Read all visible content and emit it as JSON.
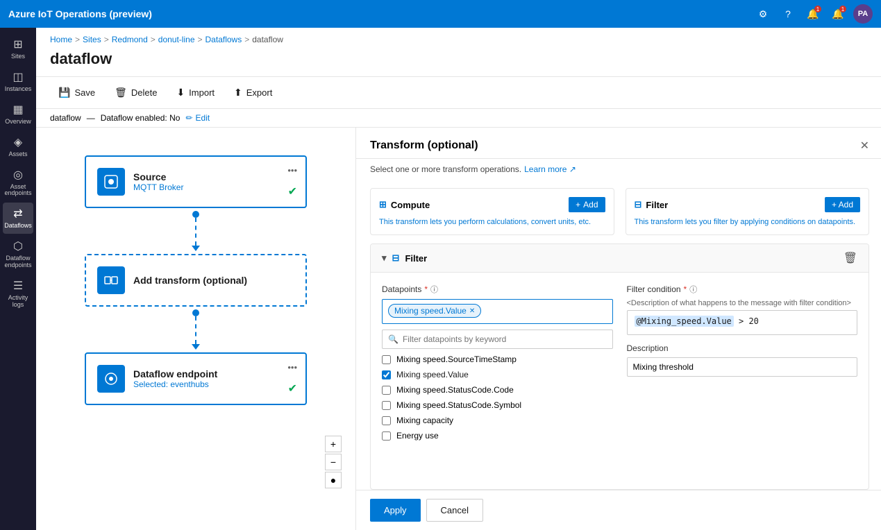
{
  "app": {
    "title": "Azure IoT Operations (preview)"
  },
  "topnav": {
    "title": "Azure IoT Operations (preview)",
    "avatar": "PA"
  },
  "breadcrumb": {
    "items": [
      "Home",
      "Sites",
      "Redmond",
      "donut-line",
      "Dataflows",
      "dataflow"
    ]
  },
  "page": {
    "title": "dataflow"
  },
  "toolbar": {
    "save": "Save",
    "delete": "Delete",
    "import": "Import",
    "export": "Export"
  },
  "dataflow_status": {
    "name": "dataflow",
    "status": "Dataflow enabled: No",
    "edit": "Edit"
  },
  "sidebar": {
    "items": [
      {
        "icon": "⊞",
        "label": "Sites"
      },
      {
        "icon": "◫",
        "label": "Instances"
      },
      {
        "icon": "▦",
        "label": "Overview"
      },
      {
        "icon": "◈",
        "label": "Assets"
      },
      {
        "icon": "◎",
        "label": "Asset endpoints"
      },
      {
        "icon": "⇄",
        "label": "Dataflows",
        "active": true
      },
      {
        "icon": "⬡",
        "label": "Dataflow endpoints"
      },
      {
        "icon": "☰",
        "label": "Activity logs"
      }
    ]
  },
  "flow": {
    "nodes": [
      {
        "id": "source",
        "title": "Source",
        "subtitle": "MQTT Broker",
        "icon": "⬡",
        "status": "ok",
        "menu": true
      },
      {
        "id": "transform",
        "title": "Add transform (optional)",
        "icon": "⊞",
        "dashed": true
      },
      {
        "id": "endpoint",
        "title": "Dataflow endpoint",
        "subtitle": "Selected: eventhubs",
        "icon": "⊙",
        "status": "ok",
        "menu": true
      }
    ]
  },
  "transform_panel": {
    "title": "Transform (optional)",
    "subtitle": "Select one or more transform operations.",
    "learn_more": "Learn more",
    "compute_card": {
      "title": "Compute",
      "add_label": "+ Add",
      "description": "This transform lets you perform calculations, convert units, etc."
    },
    "filter_card": {
      "title": "Filter",
      "add_label": "+ Add",
      "description": "This transform lets you filter by applying conditions on datapoints."
    },
    "filter_section": {
      "title": "Filter",
      "datapoints_label": "Datapoints",
      "datapoints_required": "*",
      "selected_datapoints": [
        "Mixing speed.Value"
      ],
      "search_placeholder": "Filter datapoints by keyword",
      "checkboxes": [
        {
          "label": "Mixing speed.SourceTimeStamp",
          "checked": false
        },
        {
          "label": "Mixing speed.Value",
          "checked": true
        },
        {
          "label": "Mixing speed.StatusCode.Code",
          "checked": false
        },
        {
          "label": "Mixing speed.StatusCode.Symbol",
          "checked": false
        },
        {
          "label": "Mixing capacity",
          "checked": false
        },
        {
          "label": "Energy use",
          "checked": false
        }
      ],
      "filter_condition_label": "Filter condition",
      "filter_condition_required": "*",
      "filter_condition_placeholder": "<Description of what happens to the message with filter condition>",
      "filter_condition_value": "@Mixing_speed.Value > 20",
      "description_label": "Description",
      "description_value": "Mixing threshold"
    }
  },
  "footer": {
    "apply": "Apply",
    "cancel": "Cancel"
  },
  "zoom": {
    "plus": "+",
    "minus": "−",
    "reset": "●"
  }
}
